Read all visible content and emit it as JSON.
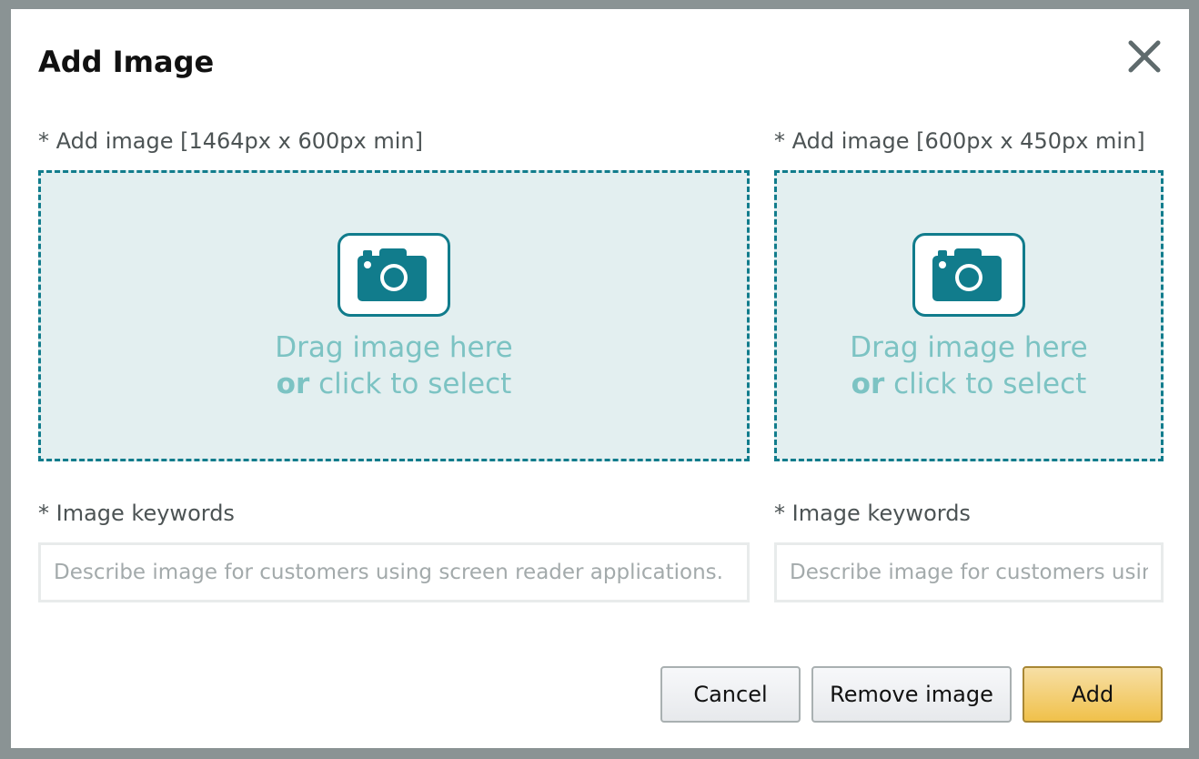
{
  "dialog": {
    "title": "Add Image",
    "close_icon": "close-icon"
  },
  "left": {
    "image_label": "* Add image [1464px x 600px min]",
    "drop_line1": "Drag image here",
    "drop_or": "or",
    "drop_line2": " click to select",
    "keywords_label": "* Image keywords",
    "keywords_placeholder": "Describe image for customers using screen reader applications.",
    "keywords_value": ""
  },
  "right": {
    "image_label": "* Add image [600px x 450px min]",
    "drop_line1": "Drag image here",
    "drop_or": "or",
    "drop_line2": " click to select",
    "keywords_label": "* Image keywords",
    "keywords_placeholder": "Describe image for customers using screen reader applications.",
    "keywords_value": ""
  },
  "buttons": {
    "cancel": "Cancel",
    "remove": "Remove image",
    "add": "Add"
  },
  "icons": {
    "camera": "camera-icon",
    "close": "close-icon"
  },
  "colors": {
    "accent": "#117c8c",
    "dropzone_bg": "#e3eff0",
    "drop_text": "#7cc3c3",
    "primary_button": "#f0c14b",
    "overlay": "#8a9394"
  }
}
